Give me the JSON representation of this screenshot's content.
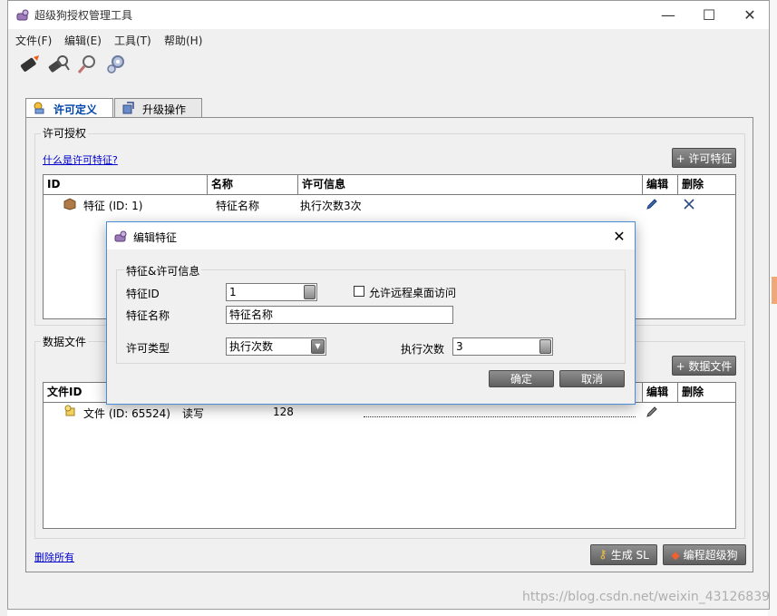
{
  "window": {
    "title": "超级狗授权管理工具",
    "minimize": "—",
    "maximize": "☐",
    "close": "✕"
  },
  "menu": [
    "文件(F)",
    "编辑(E)",
    "工具(T)",
    "帮助(H)"
  ],
  "toolbar": [
    "burn-icon",
    "search-key-icon",
    "find-icon",
    "settings-gear-icon"
  ],
  "tabs": [
    {
      "label": "许可定义",
      "active": true
    },
    {
      "label": "升级操作",
      "active": false
    }
  ],
  "license_group": {
    "title": "许可授权",
    "help_link": "什么是许可特征?",
    "add_button": "+ 许可特征",
    "columns": [
      "ID",
      "名称",
      "许可信息",
      "编辑",
      "删除"
    ],
    "rows": [
      {
        "id": "特征 (ID: 1)",
        "name": "特征名称",
        "info": "执行次数3次"
      }
    ]
  },
  "data_group": {
    "title": "数据文件",
    "add_button": "+ 数据文件",
    "columns": [
      "文件ID",
      "编辑",
      "删除"
    ],
    "rows": [
      {
        "id": "文件 (ID: 65524)",
        "access": "读写",
        "size": "128"
      }
    ]
  },
  "footer": {
    "delete_all": "删除所有",
    "generate": "生成 SL",
    "program": "编程超级狗"
  },
  "dialog": {
    "title": "编辑特征",
    "close": "✕",
    "group_title": "特征&许可信息",
    "feature_id_label": "特征ID",
    "feature_id_value": "1",
    "remote_checkbox": "允许远程桌面访问",
    "remote_checked": false,
    "feature_name_label": "特征名称",
    "feature_name_value": "特征名称",
    "license_type_label": "许可类型",
    "license_type_value": "执行次数",
    "exec_count_label": "执行次数",
    "exec_count_value": "3",
    "ok": "确定",
    "cancel": "取消"
  },
  "watermark": "https://blog.csdn.net/weixin_43126839"
}
